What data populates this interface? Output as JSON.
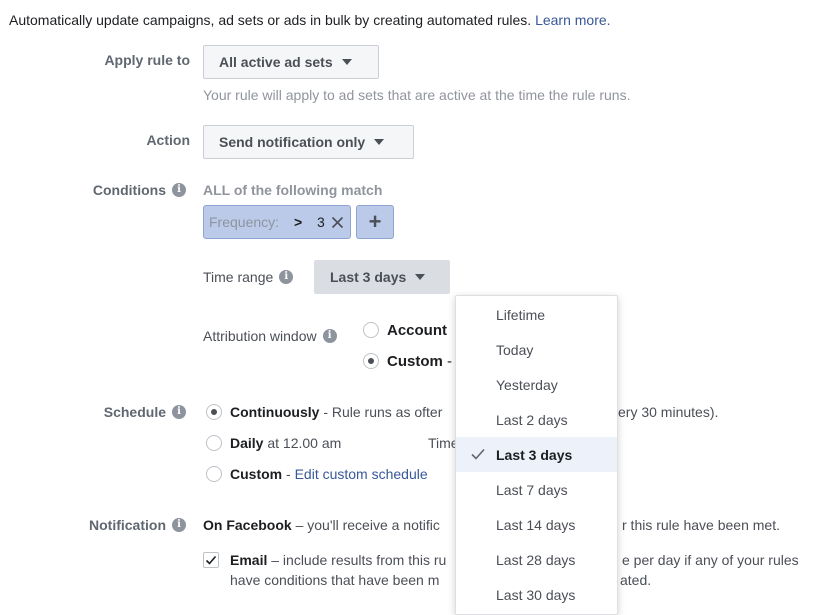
{
  "intro": {
    "text": "Automatically update campaigns, ad sets or ads in bulk by creating automated rules. ",
    "learn_more": "Learn more."
  },
  "apply_rule": {
    "label": "Apply rule to",
    "value": "All active ad sets",
    "help": "Your rule will apply to ad sets that are active at the time the rule runs."
  },
  "action": {
    "label": "Action",
    "value": "Send notification only"
  },
  "conditions": {
    "label": "Conditions",
    "match": "ALL of the following match",
    "condition": {
      "metric": "Frequency:",
      "operator": ">",
      "value": "3"
    },
    "add_symbol": "+"
  },
  "time_range": {
    "label": "Time range",
    "value": "Last 3 days",
    "options": [
      "Lifetime",
      "Today",
      "Yesterday",
      "Last 2 days",
      "Last 3 days",
      "Last 7 days",
      "Last 14 days",
      "Last 28 days",
      "Last 30 days"
    ],
    "selected": "Last 3 days"
  },
  "attribution": {
    "label": "Attribution window",
    "opt1": "Account",
    "opt2": "Custom",
    "opt2_suffix": " -"
  },
  "schedule": {
    "label": "Schedule",
    "continuous_title": "Continuously",
    "continuous_desc_a": " - Rule runs as ofter",
    "continuous_desc_b": "ery 30 minutes).",
    "daily_title": "Daily",
    "daily_desc": " at 12.00 am",
    "daily_time_fragment": "Time",
    "custom_title": "Custom",
    "custom_sep": " - ",
    "custom_link": "Edit custom schedule"
  },
  "notification": {
    "label": "Notification",
    "facebook_title": "On Facebook",
    "facebook_desc_a": " – you'll receive a notific",
    "facebook_desc_b": "r this rule have been met.",
    "email_title": "Email",
    "email_desc_a": " – include results from this ru",
    "email_desc_b": "e per day if any of your rules",
    "email_line2_a": "have conditions that have been m",
    "email_line2_b": "ated."
  },
  "icons": {
    "info": "info-icon",
    "caret": "caret-down-icon",
    "close": "close-icon",
    "check": "check-icon"
  }
}
